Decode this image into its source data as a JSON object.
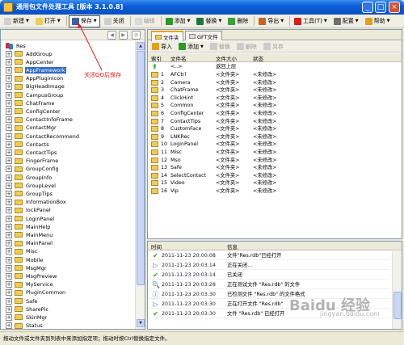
{
  "window": {
    "title": "通用包文件处理工具 [版本 3.1.0.8]",
    "minimize": "_",
    "maximize": "□",
    "close": "×"
  },
  "toolbar": [
    {
      "label": "新建",
      "icon": "new-file-icon",
      "color": "#d0d0d0",
      "dropdown": true,
      "disabled": false
    },
    {
      "label": "打开",
      "icon": "open-folder-icon",
      "color": "#f0cc55",
      "dropdown": true,
      "disabled": false
    },
    {
      "label": "保存",
      "icon": "save-icon",
      "color": "#4060a0",
      "dropdown": true,
      "disabled": false,
      "highlight": true
    },
    {
      "label": "关闭",
      "icon": "close-doc-icon",
      "color": "#cfcfcf",
      "dropdown": false,
      "disabled": false
    },
    {
      "label": "编辑",
      "icon": "edit-icon",
      "color": "#d8d8d8",
      "dropdown": false,
      "disabled": true
    },
    {
      "label": "添加",
      "icon": "add-icon",
      "color": "#2a9a2a",
      "dropdown": true,
      "disabled": false
    },
    {
      "label": "替换",
      "icon": "replace-icon",
      "color": "#1a7a3a",
      "dropdown": true,
      "disabled": false
    },
    {
      "label": "删除",
      "icon": "delete-icon",
      "color": "#3aa040",
      "dropdown": false,
      "disabled": false
    },
    {
      "label": "导出",
      "icon": "export-icon",
      "color": "#d06020",
      "dropdown": true,
      "disabled": false
    },
    {
      "label": "工具(T)",
      "icon": "tools-icon",
      "color": "#d02020",
      "dropdown": true,
      "disabled": false
    },
    {
      "label": "配置",
      "icon": "config-icon",
      "color": "#707070",
      "dropdown": true,
      "disabled": false
    },
    {
      "label": "帮助",
      "icon": "help-icon",
      "color": "#e0a020",
      "dropdown": true,
      "disabled": false
    }
  ],
  "annotation": "关闭QQ后保存",
  "tree": {
    "root": "Res",
    "items": [
      "AddGroup",
      "AppCenter",
      "AppFramework",
      "AppPluginIcon",
      "BigHeadImage",
      "CampusGroup",
      "ChatFrame",
      "ConfigCenter",
      "ContactInfoFrame",
      "ContactMgr",
      "ContactRecommend",
      "Contacts",
      "ContactTips",
      "FingerFrame",
      "GroupConfig",
      "GroupInfo",
      "GroupLevel",
      "GroupTips",
      "InformationBox",
      "lockPanel",
      "LoginPanel",
      "MainHelp",
      "MainMenu",
      "MainPanel",
      "Misc",
      "Mobile",
      "MsgMgr",
      "MsgPreview",
      "MyService",
      "PluginCommon",
      "Safe",
      "SharePic",
      "SkinMgr",
      "Status"
    ],
    "selected": "AppFramework"
  },
  "tabs": [
    {
      "label": "文件夹",
      "active": true
    },
    {
      "label": "GFT文件",
      "active": false
    }
  ],
  "subtoolbar": [
    {
      "label": "导入",
      "icon": "import-icon",
      "disabled": false,
      "dropdown": false
    },
    {
      "label": "添加",
      "icon": "add-icon",
      "disabled": false,
      "dropdown": true
    },
    {
      "label": "替换",
      "icon": "replace-icon",
      "disabled": true,
      "dropdown": false
    },
    {
      "label": "删除",
      "icon": "delete-icon",
      "disabled": true,
      "dropdown": false
    },
    {
      "label": "另存",
      "icon": "save-as-icon",
      "disabled": true,
      "dropdown": false
    }
  ],
  "table": {
    "columns": [
      "索引",
      "文件名",
      "文件大小",
      "状态"
    ],
    "up_row": {
      "name": "<..>",
      "size": "返回上层"
    },
    "rows": [
      {
        "index": "1",
        "name": "AFCtrl",
        "size": "<文件夹>",
        "status": "<未修改>"
      },
      {
        "index": "2",
        "name": "Camera",
        "size": "<文件夹>",
        "status": "<未修改>"
      },
      {
        "index": "3",
        "name": "ChatFrame",
        "size": "<文件夹>",
        "status": "<未修改>"
      },
      {
        "index": "4",
        "name": "ClickHint",
        "size": "<文件夹>",
        "status": "<未修改>"
      },
      {
        "index": "5",
        "name": "Common",
        "size": "<文件夹>",
        "status": "<未修改>"
      },
      {
        "index": "6",
        "name": "ConfigCenter",
        "size": "<文件夹>",
        "status": "<未修改>"
      },
      {
        "index": "7",
        "name": "ContactTips",
        "size": "<文件夹>",
        "status": "<未修改>"
      },
      {
        "index": "8",
        "name": "CustomFace",
        "size": "<文件夹>",
        "status": "<未修改>"
      },
      {
        "index": "9",
        "name": "LNKRec",
        "size": "<文件夹>",
        "status": "<未修改>"
      },
      {
        "index": "10",
        "name": "LoginPanel",
        "size": "<文件夹>",
        "status": "<未修改>"
      },
      {
        "index": "11",
        "name": "Misc",
        "size": "<文件夹>",
        "status": "<未修改>"
      },
      {
        "index": "12",
        "name": "Mso",
        "size": "<文件夹>",
        "status": "<未修改>"
      },
      {
        "index": "13",
        "name": "Safe",
        "size": "<文件夹>",
        "status": "<未修改>"
      },
      {
        "index": "14",
        "name": "SelectContact",
        "size": "<文件夹>",
        "status": "<未修改>"
      },
      {
        "index": "15",
        "name": "Video",
        "size": "<文件夹>",
        "status": "<未修改>"
      },
      {
        "index": "16",
        "name": "Vip",
        "size": "<文件夹>",
        "status": "<未修改>"
      }
    ]
  },
  "log": {
    "columns": [
      "时间",
      "信息"
    ],
    "rows": [
      {
        "time": "2011-11-23 20:00:08",
        "msg": "文件\"Res.rdb\"已经打开",
        "icon": "check-icon",
        "symbol": "✔",
        "color": "#2a9a2a"
      },
      {
        "time": "2011-11-23 20:03:14",
        "msg": "正在关闭...",
        "icon": "play-icon",
        "symbol": "▷",
        "color": "#2a6ad4"
      },
      {
        "time": "2011-11-23 20:03:14",
        "msg": "已关闭",
        "icon": "check-icon",
        "symbol": "✔",
        "color": "#2a9a2a"
      },
      {
        "time": "2011-11-23 20:03:28",
        "msg": "正在测试文件 \"Res.rdb\" 的文件",
        "icon": "search-icon",
        "symbol": "🔍",
        "color": "#555555"
      },
      {
        "time": "2011-11-23 20:03:30",
        "msg": "已检测文件 \"Res.rdb\" 的文件格式",
        "icon": "info-icon",
        "symbol": "ⓘ",
        "color": "#2a6ad4"
      },
      {
        "time": "2011-11-23 20:03:30",
        "msg": "正在打开文件 \"Res.rdb\"",
        "icon": "play-icon",
        "symbol": "▷",
        "color": "#2a6ad4"
      },
      {
        "time": "2011-11-23 20:03:30",
        "msg": "文件 \"Res.rdb\" 已经打开",
        "icon": "check-icon",
        "symbol": "✔",
        "color": "#2a9a2a"
      }
    ]
  },
  "watermark": {
    "main": "Baidu 经验",
    "sub": "jingyan.baidu.com"
  },
  "statusbar": "拖动文件或文件夹到列表中来添加指定项；拖动时按Ctrl替换指定文件。"
}
